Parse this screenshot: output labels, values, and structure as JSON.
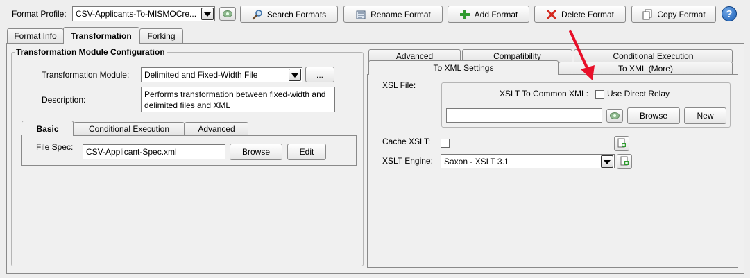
{
  "toolbar": {
    "format_profile_label": "Format Profile:",
    "format_profile_value": "CSV-Applicants-To-MISMOCre...",
    "search_label": "Search Formats",
    "rename_label": "Rename Format",
    "add_label": "Add Format",
    "delete_label": "Delete Format",
    "copy_label": "Copy Format",
    "help_glyph": "?"
  },
  "main_tabs": [
    "Format Info",
    "Transformation",
    "Forking"
  ],
  "left": {
    "group_title": "Transformation Module Configuration",
    "module_label": "Transformation Module:",
    "module_value": "Delimited and Fixed-Width File",
    "ellipsis_label": "...",
    "description_label": "Description:",
    "description_value": "Performs transformation between fixed-width and delimited files and XML",
    "sub_tabs": [
      "Basic",
      "Conditional Execution",
      "Advanced"
    ],
    "file_spec_label": "File Spec:",
    "file_spec_value": "CSV-Applicant-Spec.xml",
    "browse_label": "Browse",
    "edit_label": "Edit"
  },
  "right": {
    "tabs_back": [
      "Advanced",
      "Compatibility",
      "Conditional Execution"
    ],
    "tabs_front": [
      "To XML Settings",
      "To XML (More)"
    ],
    "xsl_file_label": "XSL File:",
    "xslt_common_label": "XSLT To Common XML:",
    "use_direct_relay_label": "Use Direct Relay",
    "xsl_file_value": "",
    "browse_label": "Browse",
    "new_label": "New",
    "cache_label": "Cache XSLT:",
    "engine_label": "XSLT Engine:",
    "engine_value": "Saxon - XSLT 3.1"
  },
  "colors": {
    "annotation_arrow": "#e8102a",
    "help_blue": "#1b5fb6",
    "add_green": "#2f9a2f",
    "delete_red": "#d4291f"
  }
}
